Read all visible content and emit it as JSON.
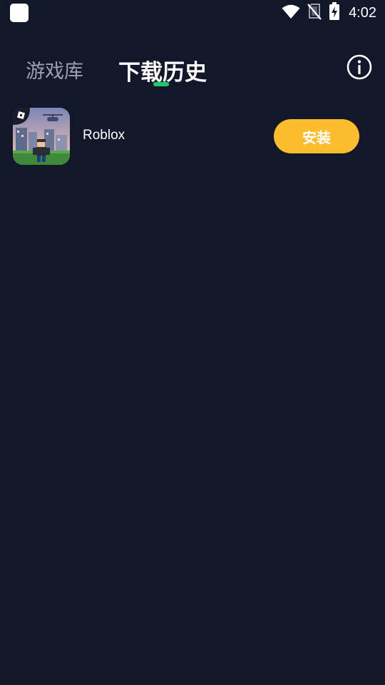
{
  "status_bar": {
    "time": "4:02",
    "icons": [
      "app-notification-icon",
      "wifi-icon",
      "no-sim-icon",
      "battery-charging-icon"
    ]
  },
  "tabs": [
    {
      "label": "游戏库",
      "active": false
    },
    {
      "label": "下载历史",
      "active": true
    }
  ],
  "colors": {
    "background": "#12182a",
    "active_indicator": "#1fc86b",
    "install_button": "#fcbd2c",
    "inactive_tab": "#9aa0ad"
  },
  "header": {
    "info_icon": "info-icon"
  },
  "downloads": [
    {
      "name": "Roblox",
      "icon": "roblox-app-icon",
      "action_label": "安装"
    }
  ]
}
